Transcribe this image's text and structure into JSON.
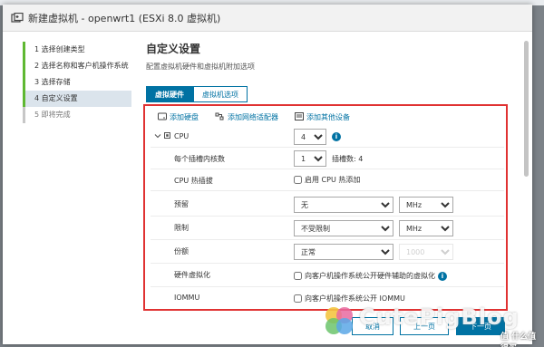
{
  "dialog": {
    "title": "新建虚拟机 - openwrt1 (ESXi 8.0 虚拟机)"
  },
  "steps": [
    {
      "label": "1 选择创建类型"
    },
    {
      "label": "2 选择名称和客户机操作系统"
    },
    {
      "label": "3 选择存储"
    },
    {
      "label": "4 自定义设置"
    },
    {
      "label": "5 即将完成"
    }
  ],
  "main": {
    "title": "自定义设置",
    "subtitle": "配置虚拟机硬件和虚拟机附加选项",
    "tabs": [
      {
        "label": "虚拟硬件"
      },
      {
        "label": "虚拟机选项"
      }
    ]
  },
  "toolbar": {
    "add_disk": "添加硬盘",
    "add_nic": "添加网络适配器",
    "add_other": "添加其他设备"
  },
  "cpu": {
    "label": "CPU",
    "count": "4",
    "cores_label": "每个插槽内核数",
    "cores_value": "1",
    "sockets_text": "插槽数: 4",
    "hotplug_label": "CPU 热插拔",
    "hotplug_option": "启用 CPU 热添加",
    "reservation_label": "预留",
    "reservation_value": "无",
    "reservation_unit": "MHz",
    "limit_label": "限制",
    "limit_value": "不受限制",
    "limit_unit": "MHz",
    "shares_label": "份额",
    "shares_value": "正常",
    "shares_number": "1000",
    "hwvirt_label": "硬件虚拟化",
    "hwvirt_option": "向客户机操作系统公开硬件辅助的虚拟化",
    "iommu_label": "IOMMU",
    "iommu_option": "向客户机操作系统公开 IOMMU"
  },
  "footer": {
    "cancel": "取消",
    "back": "上一页",
    "next": "下一页"
  },
  "watermark": {
    "text": "CutePigBlog",
    "sub": "值 什么值得买"
  }
}
